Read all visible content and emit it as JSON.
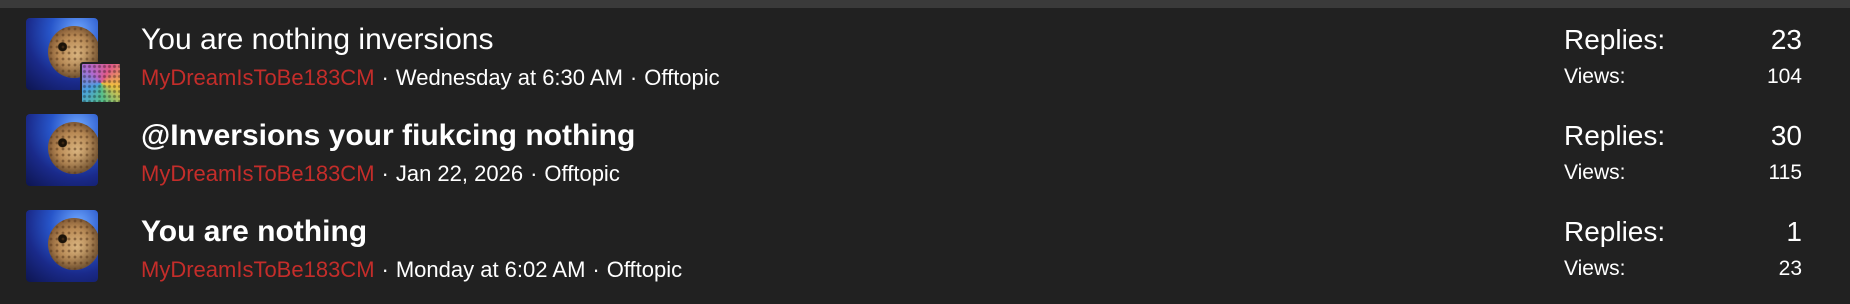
{
  "threads": [
    {
      "title": "You are nothing inversions",
      "author": "MyDreamIsToBe183CM",
      "date": "Wednesday at 6:30 AM",
      "forum": "Offtopic",
      "replies_label": "Replies:",
      "replies": "23",
      "views_label": "Views:",
      "views": "104",
      "unread": false,
      "has_last_poster_avatar": true
    },
    {
      "title": "@Inversions your fiukcing nothing",
      "author": "MyDreamIsToBe183CM",
      "date": "Jan 22, 2026",
      "forum": "Offtopic",
      "replies_label": "Replies:",
      "replies": "30",
      "views_label": "Views:",
      "views": "115",
      "unread": true,
      "has_last_poster_avatar": false
    },
    {
      "title": "You are nothing",
      "author": "MyDreamIsToBe183CM",
      "date": "Monday at 6:02 AM",
      "forum": "Offtopic",
      "replies_label": "Replies:",
      "replies": "1",
      "views_label": "Views:",
      "views": "23",
      "unread": true,
      "has_last_poster_avatar": false
    }
  ],
  "separator": "·",
  "colors": {
    "background": "#212121",
    "author": "#c42d2a",
    "text": "#ffffff"
  }
}
